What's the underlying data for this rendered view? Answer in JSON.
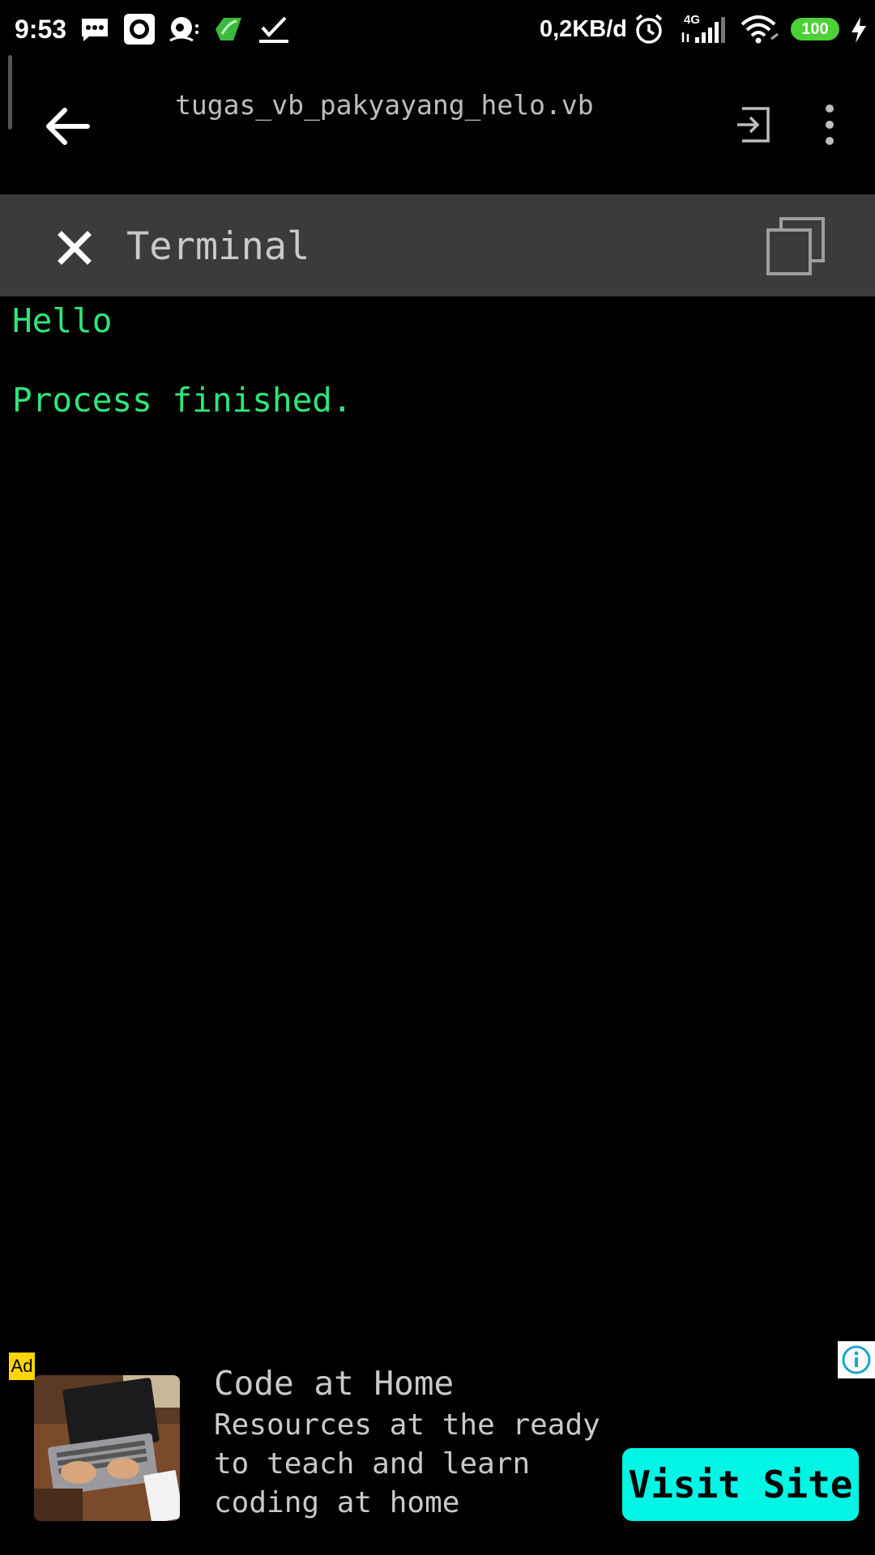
{
  "status_bar": {
    "time": "9:53",
    "network_speed": "0,2KB/d",
    "network_type": "4G",
    "battery_level": "100",
    "icons": [
      "message-icon",
      "record-icon",
      "app-icon",
      "leaf-app-icon",
      "check-icon",
      "alarm-icon",
      "signal-icon",
      "wifi-icon",
      "charging-icon"
    ]
  },
  "toolbar": {
    "title": "tugas_vb_pakyayang_helo.vb",
    "back_icon": "arrow-left-icon",
    "enter_icon": "enter-icon",
    "more_icon": "more-vertical-icon"
  },
  "terminal": {
    "title": "Terminal",
    "close_icon": "close-icon",
    "copy_icon": "copy-icon",
    "output_lines": [
      "Hello",
      "",
      "Process finished."
    ],
    "text_color": "#2ee67a"
  },
  "ad": {
    "badge": "Ad",
    "info_icon": "info-icon",
    "title": "Code at Home",
    "body_lines": [
      "Resources at the ready",
      "to teach and learn",
      "coding at home"
    ],
    "cta_label": "Visit Site",
    "cta_color": "#00f5e4"
  }
}
